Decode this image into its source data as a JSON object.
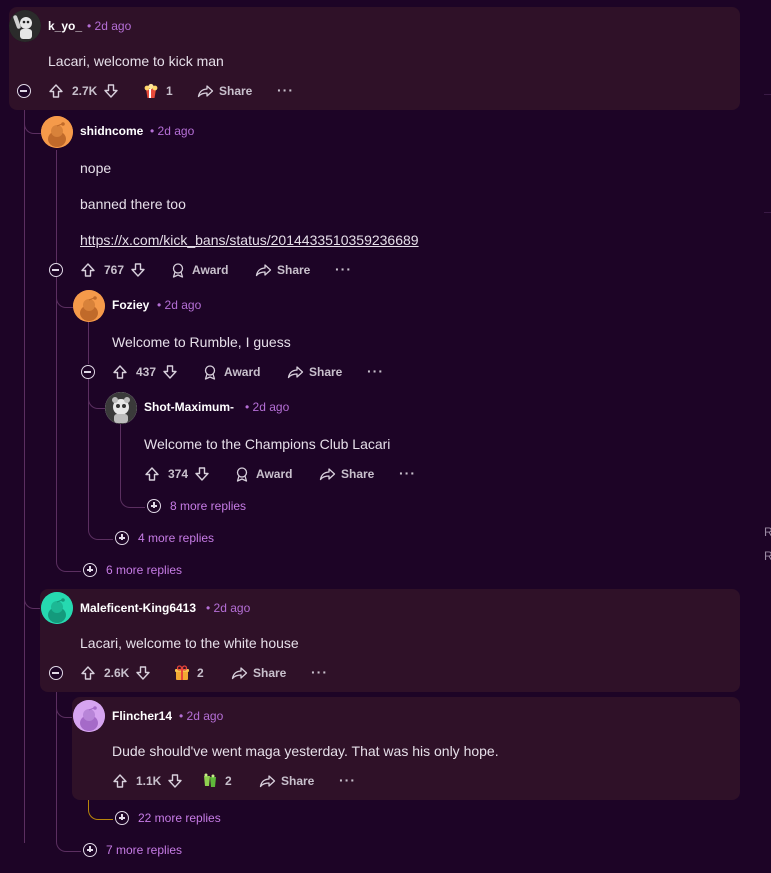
{
  "comments": [
    {
      "username": "k_yo_",
      "time": "• 2d ago",
      "body": [
        "Lacari, welcome to kick man"
      ],
      "votes": "2.7K",
      "award_count": "1",
      "share": "Share",
      "avatar_color": "#2a2a2a"
    },
    {
      "username": "shidncome",
      "time": "• 2d ago",
      "body": [
        "nope",
        "banned there too"
      ],
      "link": "https://x.com/kick_bans/status/2014433510359236689",
      "votes": "767",
      "award": "Award",
      "share": "Share",
      "avatar_color": "#f59a4a"
    },
    {
      "username": "Foziey",
      "time": "• 2d ago",
      "body": [
        "Welcome to Rumble, I guess"
      ],
      "votes": "437",
      "award": "Award",
      "share": "Share",
      "avatar_color": "#f59a4a"
    },
    {
      "username": "Shot-Maximum-",
      "time": "• 2d ago",
      "body": [
        "Welcome to the Champions Club Lacari"
      ],
      "votes": "374",
      "award": "Award",
      "share": "Share",
      "avatar_color": "#d9d9d9"
    },
    {
      "username": "Maleficent-King6413",
      "time": "• 2d ago",
      "body": [
        "Lacari, welcome to the white house"
      ],
      "votes": "2.6K",
      "award_count": "2",
      "share": "Share",
      "avatar_color": "#26d9b0"
    },
    {
      "username": "Flincher14",
      "time": "• 2d ago",
      "body": [
        "Dude should've went maga yesterday. That was his only hope."
      ],
      "votes": "1.1K",
      "award_count": "2",
      "share": "Share",
      "avatar_color": "#d6a4f0"
    }
  ],
  "more_replies": [
    "8 more replies",
    "4 more replies",
    "6 more replies",
    "22 more replies",
    "7 more replies"
  ],
  "overflow": "···",
  "side_letters": [
    "R",
    "R"
  ],
  "colors": {
    "background": "#1d0426",
    "highlight": "#2f1128",
    "accent": "#c77ce6",
    "thread_line": "#5b2f60",
    "gold_line": "#b8860b"
  }
}
